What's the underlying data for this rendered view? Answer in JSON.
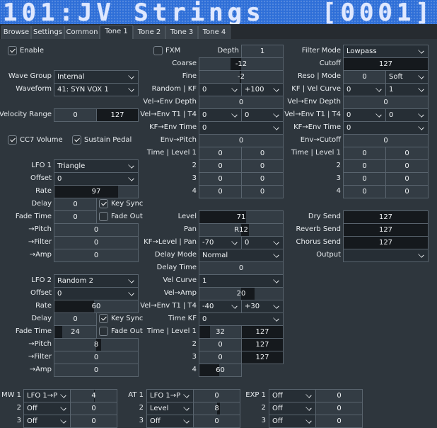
{
  "title": {
    "patch": "101:JV Strings",
    "code": "[0001]",
    "lcd_color": "#2f6fd8"
  },
  "tabs": [
    {
      "label": "Browse"
    },
    {
      "label": "Settings"
    },
    {
      "label": "Common"
    },
    {
      "label": "Tone 1",
      "active": true
    },
    {
      "label": "Tone 2"
    },
    {
      "label": "Tone 3"
    },
    {
      "label": "Tone 4"
    }
  ],
  "tone": {
    "enable": {
      "label": "Enable",
      "checked": true
    },
    "wave_group": {
      "label": "Wave Group",
      "value": "Internal"
    },
    "waveform": {
      "label": "Waveform",
      "value": "41: SYN VOX 1"
    },
    "velocity_range": {
      "label": "Velocity Range",
      "low": {
        "value": "0",
        "fill": 0
      },
      "high": {
        "value": "127",
        "fill": 1
      }
    },
    "cc7_volume": {
      "label": "CC7 Volume",
      "checked": true
    },
    "sustain_pedal": {
      "label": "Sustain Pedal",
      "checked": true
    }
  },
  "lfo1": {
    "label": "LFO 1",
    "waveform": {
      "value": "Triangle"
    },
    "offset": {
      "label": "Offset",
      "value": "0"
    },
    "rate": {
      "label": "Rate",
      "value": "97",
      "fill": 0.764
    },
    "delay": {
      "label": "Delay",
      "value": "0",
      "fill": 0
    },
    "key_sync": {
      "label": "Key Sync",
      "checked": true
    },
    "fade_time": {
      "label": "Fade Time",
      "value": "0",
      "fill": 0
    },
    "fade_out": {
      "label": "Fade Out",
      "checked": false
    },
    "pitch": {
      "label": "→Pitch",
      "value": "0",
      "bipolar": 0
    },
    "filter": {
      "label": "→Filter",
      "value": "0",
      "bipolar": 0
    },
    "amp": {
      "label": "→Amp",
      "value": "0",
      "bipolar": 0
    }
  },
  "lfo2": {
    "label": "LFO 2",
    "waveform": {
      "value": "Random 2"
    },
    "offset": {
      "label": "Offset",
      "value": "0"
    },
    "rate": {
      "label": "Rate",
      "value": "60",
      "fill": 0.472
    },
    "delay": {
      "label": "Delay",
      "value": "0",
      "fill": 0
    },
    "key_sync": {
      "label": "Key Sync",
      "checked": true
    },
    "fade_time": {
      "label": "Fade Time",
      "value": "24",
      "fill": 0.189
    },
    "fade_out": {
      "label": "Fade Out",
      "checked": false
    },
    "pitch": {
      "label": "→Pitch",
      "value": "8",
      "bipolar": 0.127
    },
    "filter": {
      "label": "→Filter",
      "value": "0",
      "bipolar": 0
    },
    "amp": {
      "label": "→Amp",
      "value": "0",
      "bipolar": 0
    }
  },
  "pitch": {
    "fxm": {
      "label": "FXM",
      "checked": false
    },
    "depth": {
      "label": "Depth",
      "value": "1",
      "fill": 0
    },
    "coarse": {
      "label": "Coarse",
      "value": "-12",
      "bipolar": -0.25
    },
    "fine": {
      "label": "Fine",
      "value": "-2",
      "bipolar": -0.04
    },
    "random_kf": {
      "label": "Random | KF",
      "a": {
        "value": "0"
      },
      "b": {
        "value": "+100"
      }
    },
    "vel_env_depth": {
      "label": "Vel→Env Depth",
      "value": "0",
      "bipolar": 0
    },
    "vel_env_t1_t4": {
      "label": "Vel→Env T1 | T4",
      "a": {
        "value": "0"
      },
      "b": {
        "value": "0"
      }
    },
    "kf_env_time": {
      "label": "KF→Env Time",
      "value": "0"
    },
    "env_pitch": {
      "label": "Env→Pitch",
      "value": "0",
      "bipolar": 0
    },
    "env": [
      {
        "label": "Time | Level 1",
        "time": {
          "value": "0",
          "fill": 0
        },
        "level": {
          "value": "0",
          "bipolar": 0
        }
      },
      {
        "label": "2",
        "time": {
          "value": "0",
          "fill": 0
        },
        "level": {
          "value": "0",
          "bipolar": 0
        }
      },
      {
        "label": "3",
        "time": {
          "value": "0",
          "fill": 0
        },
        "level": {
          "value": "0",
          "bipolar": 0
        }
      },
      {
        "label": "4",
        "time": {
          "value": "0",
          "fill": 0
        },
        "level": {
          "value": "0",
          "bipolar": 0
        }
      }
    ]
  },
  "filter": {
    "mode": {
      "label": "Filter Mode",
      "value": "Lowpass"
    },
    "cutoff": {
      "label": "Cutoff",
      "value": "127",
      "fill": 1
    },
    "reso_mode": {
      "label": "Reso | Mode",
      "reso": {
        "value": "0",
        "fill": 0
      },
      "mode": {
        "value": "Soft"
      }
    },
    "kf_vel_curve": {
      "label": "KF | Vel Curve",
      "a": {
        "value": "0"
      },
      "b": {
        "value": "1"
      }
    },
    "vel_env_depth": {
      "label": "Vel→Env Depth",
      "value": "0",
      "bipolar": 0
    },
    "vel_env_t1_t4": {
      "label": "Vel→Env T1 | T4",
      "a": {
        "value": "0"
      },
      "b": {
        "value": "0"
      }
    },
    "kf_env_time": {
      "label": "KF→Env Time",
      "value": "0"
    },
    "env_cutoff": {
      "label": "Env→Cutoff",
      "value": "0",
      "bipolar": 0
    },
    "env": [
      {
        "label": "Time | Level 1",
        "time": {
          "value": "0",
          "fill": 0
        },
        "level": {
          "value": "0",
          "fill": 0
        }
      },
      {
        "label": "2",
        "time": {
          "value": "0",
          "fill": 0
        },
        "level": {
          "value": "0",
          "fill": 0
        }
      },
      {
        "label": "3",
        "time": {
          "value": "0",
          "fill": 0
        },
        "level": {
          "value": "0",
          "fill": 0
        }
      },
      {
        "label": "4",
        "time": {
          "value": "0",
          "fill": 0
        },
        "level": {
          "value": "0",
          "fill": 0
        }
      }
    ]
  },
  "amp": {
    "level": {
      "label": "Level",
      "value": "71",
      "fill": 0.559
    },
    "pan": {
      "label": "Pan",
      "value": "R12",
      "bipolar": 0.19
    },
    "kf_level_pan": {
      "label": "KF→Level | Pan",
      "a": {
        "value": "-70"
      },
      "b": {
        "value": "0"
      }
    },
    "delay_mode": {
      "label": "Delay Mode",
      "value": "Normal"
    },
    "delay_time": {
      "label": "Delay Time",
      "value": "0",
      "fill": 0
    },
    "vel_curve": {
      "label": "Vel Curve",
      "value": "1"
    },
    "vel_amp": {
      "label": "Vel→Amp",
      "value": "20",
      "bipolar": 0.32
    },
    "vel_env_t1_t4": {
      "label": "Vel→Env T1 | T4",
      "a": {
        "value": "-40"
      },
      "b": {
        "value": "+30"
      }
    },
    "time_kf": {
      "label": "Time KF",
      "value": "0"
    },
    "env": [
      {
        "label": "Time | Level 1",
        "time": {
          "value": "32",
          "fill": 0.252
        },
        "level": {
          "value": "127",
          "fill": 1
        }
      },
      {
        "label": "2",
        "time": {
          "value": "0",
          "fill": 0
        },
        "level": {
          "value": "127",
          "fill": 1
        }
      },
      {
        "label": "3",
        "time": {
          "value": "0",
          "fill": 0
        },
        "level": {
          "value": "127",
          "fill": 1
        }
      },
      {
        "label": "4",
        "time": {
          "value": "60",
          "fill": 0.472
        }
      }
    ]
  },
  "output": {
    "dry_send": {
      "label": "Dry Send",
      "value": "127",
      "fill": 1
    },
    "reverb_send": {
      "label": "Reverb Send",
      "value": "127",
      "fill": 1
    },
    "chorus_send": {
      "label": "Chorus Send",
      "value": "127",
      "fill": 1
    },
    "output": {
      "label": "Output",
      "value": ""
    }
  },
  "modulation": {
    "mw": [
      {
        "label": "MW 1",
        "dest": {
          "value": "LFO 1→Pitch"
        },
        "amount": {
          "value": "4",
          "bipolar": 0.05
        }
      },
      {
        "label": "2",
        "dest": {
          "value": "Off"
        },
        "amount": {
          "value": "0",
          "bipolar": 0
        }
      },
      {
        "label": "3",
        "dest": {
          "value": "Off"
        },
        "amount": {
          "value": "0",
          "bipolar": 0
        }
      }
    ],
    "at": [
      {
        "label": "AT 1",
        "dest": {
          "value": "LFO 1→Pitch"
        },
        "amount": {
          "value": "0",
          "bipolar": 0
        }
      },
      {
        "label": "2",
        "dest": {
          "value": "Level"
        },
        "amount": {
          "value": "8",
          "bipolar": 0.13
        }
      },
      {
        "label": "3",
        "dest": {
          "value": "Off"
        },
        "amount": {
          "value": "0",
          "bipolar": 0
        }
      }
    ],
    "exp": [
      {
        "label": "EXP 1",
        "dest": {
          "value": "Off"
        },
        "amount": {
          "value": "0",
          "bipolar": 0
        }
      },
      {
        "label": "2",
        "dest": {
          "value": "Off"
        },
        "amount": {
          "value": "0",
          "bipolar": 0
        }
      },
      {
        "label": "3",
        "dest": {
          "value": "Off"
        },
        "amount": {
          "value": "0",
          "bipolar": 0
        }
      }
    ]
  }
}
